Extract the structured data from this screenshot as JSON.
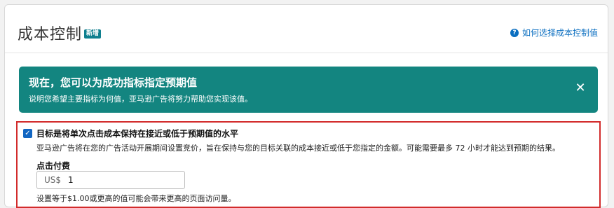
{
  "header": {
    "title": "成本控制",
    "badge": "新增",
    "help_link": "如何选择成本控制值"
  },
  "banner": {
    "title": "现在，您可以为成功指标指定预期值",
    "body": "说明您希望主要指标为何值，亚马逊广告将努力帮助您实现该值。",
    "close_icon": "✕"
  },
  "goal": {
    "checked": true,
    "label": "目标是将单次点击成本保持在接近或低于预期值的水平",
    "description": "亚马逊广告将在您的广告活动开展期间设置竞价，旨在保持与您的目标关联的成本接近或低于您指定的金额。可能需要最多 72 小时才能达到预期的结果。",
    "cpc_label": "点击付费",
    "currency": "US$",
    "cpc_value": "1",
    "hint": "设置等于$1.00或更高的值可能会带来更高的页面访问量。"
  },
  "colors": {
    "banner": "#138580",
    "accent": "#1266c2",
    "highlight_border": "#d22b2b",
    "link": "#0a6ec0"
  }
}
